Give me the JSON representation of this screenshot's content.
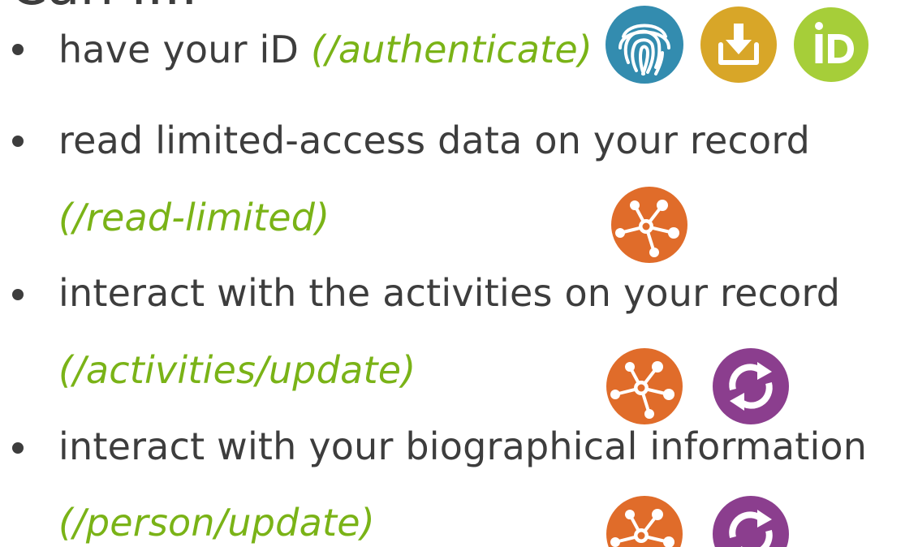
{
  "heading": "Can I...",
  "items": [
    {
      "text": "have your iD ",
      "scope": "(/authenticate)"
    },
    {
      "text": "read limited-access data on your record",
      "scope": "(/read-limited)"
    },
    {
      "text": "interact with the activities on your record",
      "scope": "(/activities/update)"
    },
    {
      "text": "interact with your biographical information",
      "scope": "(/person/update)"
    }
  ],
  "colors": {
    "text": "#3d3d3d",
    "scope": "#7ab317",
    "fingerprint": "#338caf",
    "download": "#d8a628",
    "orcid": "#a6ce39",
    "network": "#e06c2a",
    "sync": "#8b3e8e"
  },
  "icons": {
    "authenticate": [
      "fingerprint-icon",
      "download-icon",
      "orcid-icon"
    ],
    "read_limited": [
      "network-icon"
    ],
    "activities_update": [
      "network-icon",
      "sync-icon"
    ],
    "person_update": [
      "network-icon",
      "sync-icon"
    ]
  },
  "orcid_logo_text": "iD"
}
